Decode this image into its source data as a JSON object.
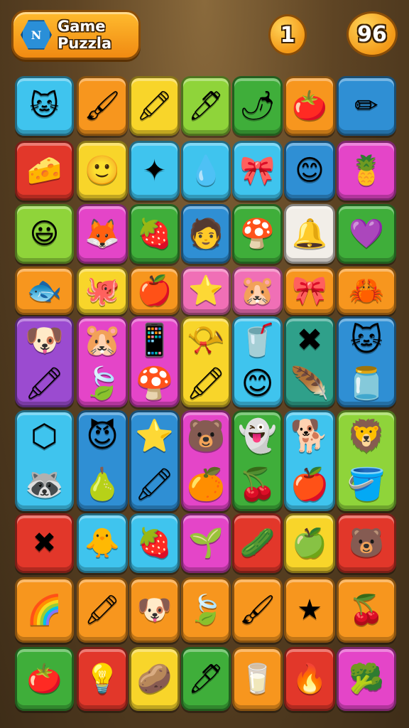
{
  "header": {
    "title_line1": "Game",
    "title_line2": "Puzzla",
    "logo_letter": "N",
    "level_value": "1",
    "score_value": "96"
  },
  "colors": {
    "cyan": "#3fc4ee",
    "orange": "#f7961e",
    "yellow": "#f8d52a",
    "lime": "#8fd43a",
    "green": "#3fae3a",
    "blue": "#2f8fd4",
    "red": "#e2372a",
    "magenta": "#e445c8",
    "purple": "#9b4bd0",
    "pink": "#f06fb6",
    "teal": "#2fa08a",
    "white": "#f2eee8"
  },
  "tiles": [
    {
      "name": "cat-face-tile",
      "icon": "cat-face-icon",
      "glyph": "🐱",
      "color": "#3fc4ee"
    },
    {
      "name": "brush-tile",
      "icon": "brush-icon",
      "glyph": "🖌",
      "color": "#f7961e"
    },
    {
      "name": "red-crayon-tile",
      "icon": "crayon-icon",
      "glyph": "🖍",
      "color": "#f8d52a"
    },
    {
      "name": "blue-marker-tile",
      "icon": "marker-icon",
      "glyph": "🖊",
      "color": "#8fd43a"
    },
    {
      "name": "chili-pepper-tile",
      "icon": "chili-icon",
      "glyph": "🌶",
      "color": "#3fae3a"
    },
    {
      "name": "tomato-face-tile",
      "icon": "tomato-icon",
      "glyph": "🍅",
      "color": "#f7961e"
    },
    {
      "name": "crossed-pencil-tile",
      "icon": "pencil-icon",
      "glyph": "✏",
      "color": "#2f8fd4"
    },
    {
      "name": "cheese-face-tile",
      "icon": "cheese-icon",
      "glyph": "🧀",
      "color": "#e2372a"
    },
    {
      "name": "green-hair-face-tile",
      "icon": "face-icon",
      "glyph": "🙂",
      "color": "#f8d52a"
    },
    {
      "name": "pink-star-tile",
      "icon": "star-icon",
      "glyph": "✦",
      "color": "#3fc4ee"
    },
    {
      "name": "water-drop-tile",
      "icon": "drop-icon",
      "glyph": "💧",
      "color": "#3fc4ee"
    },
    {
      "name": "bow-tile",
      "icon": "bow-icon",
      "glyph": "🎀",
      "color": "#3fc4ee"
    },
    {
      "name": "hat-face-tile",
      "icon": "hat-face-icon",
      "glyph": "😊",
      "color": "#2f8fd4"
    },
    {
      "name": "leafy-fruit-tile",
      "icon": "leaf-icon",
      "glyph": "🍍",
      "color": "#e445c8"
    },
    {
      "name": "smiley-tile",
      "icon": "smiley-icon",
      "glyph": "😃",
      "color": "#8fd43a"
    },
    {
      "name": "fox-face-tile",
      "icon": "fox-icon",
      "glyph": "🦊",
      "color": "#e445c8"
    },
    {
      "name": "radish-tile",
      "icon": "radish-icon",
      "glyph": "🍓",
      "color": "#3fae3a"
    },
    {
      "name": "boy-face-tile",
      "icon": "face-icon",
      "glyph": "🧑",
      "color": "#2f8fd4"
    },
    {
      "name": "mushroom-tile",
      "icon": "mushroom-icon",
      "glyph": "🍄",
      "color": "#3fae3a"
    },
    {
      "name": "bell-tile",
      "icon": "bell-icon",
      "glyph": "🔔",
      "color": "#f2eee8"
    },
    {
      "name": "heart-leaf-tile",
      "icon": "heart-icon",
      "glyph": "💜",
      "color": "#3fae3a"
    },
    {
      "name": "fish-tile",
      "icon": "fish-icon",
      "glyph": "🐟",
      "color": "#f7961e"
    },
    {
      "name": "octopus-tile",
      "icon": "octopus-icon",
      "glyph": "🐙",
      "color": "#f8d52a"
    },
    {
      "name": "apple-face-tile",
      "icon": "apple-icon",
      "glyph": "🍎",
      "color": "#f7961e"
    },
    {
      "name": "cookie-star-tile",
      "icon": "star-icon",
      "glyph": "⭐",
      "color": "#f06fb6"
    },
    {
      "name": "hamster-tile",
      "icon": "hamster-icon",
      "glyph": "🐹",
      "color": "#f06fb6"
    },
    {
      "name": "purple-bow-tile",
      "icon": "bow-icon",
      "glyph": "🎀",
      "color": "#f7961e"
    },
    {
      "name": "red-blob-tile",
      "icon": "blob-icon",
      "glyph": "🦀",
      "color": "#f7961e"
    }
  ],
  "tall_tiles": [
    {
      "name": "puppy-crayon-tile",
      "top": "dog-icon",
      "top_glyph": "🐶",
      "bottom": "crayon-icon",
      "bottom_glyph": "🖍",
      "color": "#9b4bd0"
    },
    {
      "name": "hamster-leaf-tile",
      "top": "hamster-icon",
      "top_glyph": "🐹",
      "bottom": "leaf-icon",
      "bottom_glyph": "🍃",
      "color": "#e445c8"
    },
    {
      "name": "tablet-mushroom-tile",
      "top": "tablet-icon",
      "top_glyph": "📱",
      "bottom": "mushroom-icon",
      "bottom_glyph": "🍄",
      "color": "#e445c8"
    },
    {
      "name": "horn-crayon-tile",
      "top": "horn-icon",
      "top_glyph": "📯",
      "bottom": "crayon-icon",
      "bottom_glyph": "🖍",
      "color": "#f8d52a"
    },
    {
      "name": "cup-blob-tile",
      "top": "cup-icon",
      "top_glyph": "🥤",
      "bottom": "blob-icon",
      "bottom_glyph": "😊",
      "color": "#3fc4ee"
    },
    {
      "name": "cross-feather-tile",
      "top": "cross-icon",
      "top_glyph": "✖",
      "bottom": "feather-icon",
      "bottom_glyph": "🪶",
      "color": "#2fa08a"
    },
    {
      "name": "cat-jar-tile",
      "top": "cat-face-icon",
      "top_glyph": "🐱",
      "bottom": "jar-icon",
      "bottom_glyph": "🫙",
      "color": "#2f8fd4"
    },
    {
      "name": "hex-raccoon-tile",
      "top": "hexagon-icon",
      "top_glyph": "⬡",
      "bottom": "raccoon-icon",
      "bottom_glyph": "🦝",
      "color": "#3fc4ee"
    },
    {
      "name": "devil-pear-tile",
      "top": "devil-icon",
      "top_glyph": "😈",
      "bottom": "pear-icon",
      "bottom_glyph": "🍐",
      "color": "#2f8fd4"
    },
    {
      "name": "star-crayon-tile",
      "top": "star-icon",
      "top_glyph": "⭐",
      "bottom": "crayon-icon",
      "bottom_glyph": "🖍",
      "color": "#2f8fd4"
    },
    {
      "name": "bear-orange-tile",
      "top": "bear-icon",
      "top_glyph": "🐻",
      "bottom": "orange-icon",
      "bottom_glyph": "🍊",
      "color": "#e445c8"
    },
    {
      "name": "ghost-cherry-tile",
      "top": "ghost-icon",
      "top_glyph": "👻",
      "bottom": "cherry-icon",
      "bottom_glyph": "🍒",
      "color": "#3fae3a"
    },
    {
      "name": "dog-apple-tile",
      "top": "dog-icon",
      "top_glyph": "🐕",
      "bottom": "apple-icon",
      "bottom_glyph": "🍎",
      "color": "#3fc4ee"
    },
    {
      "name": "lion-bucket-tile",
      "top": "lion-icon",
      "top_glyph": "🦁",
      "bottom": "bucket-icon",
      "bottom_glyph": "🪣",
      "color": "#8fd43a"
    }
  ],
  "tiles2": [
    {
      "name": "cross-tile",
      "icon": "cross-icon",
      "glyph": "✖",
      "color": "#e2372a"
    },
    {
      "name": "chick-face-tile",
      "icon": "chick-icon",
      "glyph": "🐥",
      "color": "#3fc4ee"
    },
    {
      "name": "strawberry-face-tile",
      "icon": "strawberry-icon",
      "glyph": "🍓",
      "color": "#3fc4ee"
    },
    {
      "name": "sprout-tile",
      "icon": "sprout-icon",
      "glyph": "🌱",
      "color": "#e445c8"
    },
    {
      "name": "cucumber-tile",
      "icon": "cucumber-icon",
      "glyph": "🥒",
      "color": "#e2372a"
    },
    {
      "name": "green-face-tile",
      "icon": "face-icon",
      "glyph": "🍏",
      "color": "#f8d52a"
    },
    {
      "name": "pink-bear-tile",
      "icon": "bear-icon",
      "glyph": "🐻",
      "color": "#e2372a"
    },
    {
      "name": "rainbow-tablet-tile",
      "icon": "tablet-icon",
      "glyph": "🌈",
      "color": "#f7961e"
    },
    {
      "name": "green-crayon-tile",
      "icon": "crayon-icon",
      "glyph": "🖍",
      "color": "#f7961e"
    },
    {
      "name": "puppy-face-tile",
      "icon": "dog-icon",
      "glyph": "🐶",
      "color": "#f7961e"
    },
    {
      "name": "leaf-pen-tile",
      "icon": "leaf-icon",
      "glyph": "🍃",
      "color": "#f7961e"
    },
    {
      "name": "blue-brush-tile",
      "icon": "brush-icon",
      "glyph": "🖌",
      "color": "#f7961e"
    },
    {
      "name": "purple-star-tile",
      "icon": "star-icon",
      "glyph": "★",
      "color": "#f7961e"
    },
    {
      "name": "berry-face-tile",
      "icon": "berry-icon",
      "glyph": "🍒",
      "color": "#f7961e"
    },
    {
      "name": "tomato-tile",
      "icon": "tomato-icon",
      "glyph": "🍅",
      "color": "#3fae3a"
    },
    {
      "name": "lightbulb-tile",
      "icon": "bulb-icon",
      "glyph": "💡",
      "color": "#e2372a"
    },
    {
      "name": "potato-face-tile",
      "icon": "potato-icon",
      "glyph": "🥔",
      "color": "#f8d52a"
    },
    {
      "name": "green-pen-tile",
      "icon": "pen-icon",
      "glyph": "🖊",
      "color": "#3fae3a"
    },
    {
      "name": "paint-cup-tile",
      "icon": "cup-icon",
      "glyph": "🥛",
      "color": "#f7961e"
    },
    {
      "name": "flame-face-tile",
      "icon": "flame-icon",
      "glyph": "🔥",
      "color": "#e2372a"
    },
    {
      "name": "broccoli-tile",
      "icon": "broccoli-icon",
      "glyph": "🥦",
      "color": "#e445c8"
    }
  ]
}
